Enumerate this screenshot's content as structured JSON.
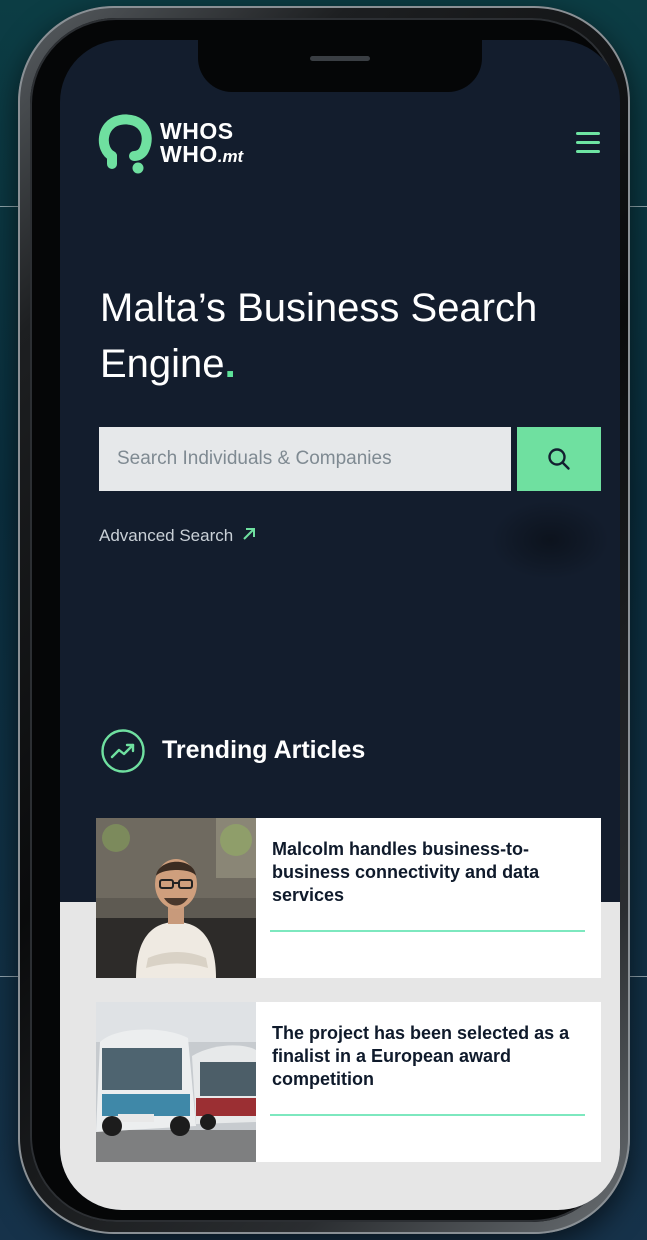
{
  "brand": {
    "name_line1": "WHOS",
    "name_line2": "WHO",
    "tld": ".mt",
    "accent_color": "#6fe0a0"
  },
  "header": {
    "menu_icon": "hamburger-menu-icon"
  },
  "hero": {
    "headline": "Malta’s Business Search Engine",
    "headline_dot": "."
  },
  "search": {
    "placeholder": "Search Individuals & Companies",
    "value": "",
    "button_icon": "search-icon"
  },
  "advanced_search": {
    "label": "Advanced Search",
    "icon": "arrow-up-right-icon"
  },
  "trending": {
    "title": "Trending Articles",
    "icon": "trending-up-icon",
    "articles": [
      {
        "title": "Malcolm handles business-to-business connectivity and data services",
        "image": "man-portrait-photo"
      },
      {
        "title": "The project has been selected as a finalist in a European award competition",
        "image": "buses-photo"
      }
    ]
  }
}
